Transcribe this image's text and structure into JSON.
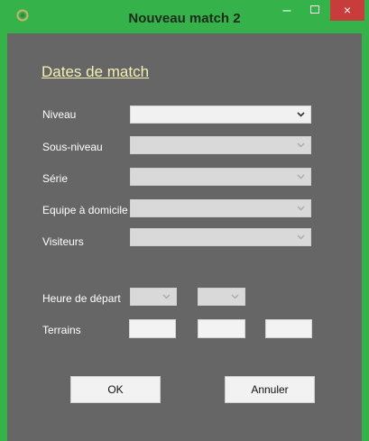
{
  "window": {
    "title": "Nouveau match 2",
    "minimize_glyph": "–",
    "close_glyph": "×",
    "icon": "app-logo-icon"
  },
  "form": {
    "section_title": "Dates de match",
    "fields": [
      {
        "label": "Niveau",
        "value": "",
        "enabled": true
      },
      {
        "label": "Sous-niveau",
        "value": "",
        "enabled": false
      },
      {
        "label": "Série",
        "value": "",
        "enabled": false
      },
      {
        "label": "Equipe à domicile",
        "value": "",
        "enabled": false
      },
      {
        "label": "Visiteurs",
        "value": "",
        "enabled": false
      }
    ],
    "heure_label": "Heure de départ",
    "heure_hour": "",
    "heure_minute": "",
    "terrains_label": "Terrains",
    "terrains_values": [
      "",
      "",
      ""
    ],
    "ok_label": "OK",
    "cancel_label": "Annuler"
  },
  "colors": {
    "titlebar": "#35b34a",
    "client_bg": "#666666",
    "section_title": "#f7f0b4",
    "close_button": "#c83c3b"
  }
}
